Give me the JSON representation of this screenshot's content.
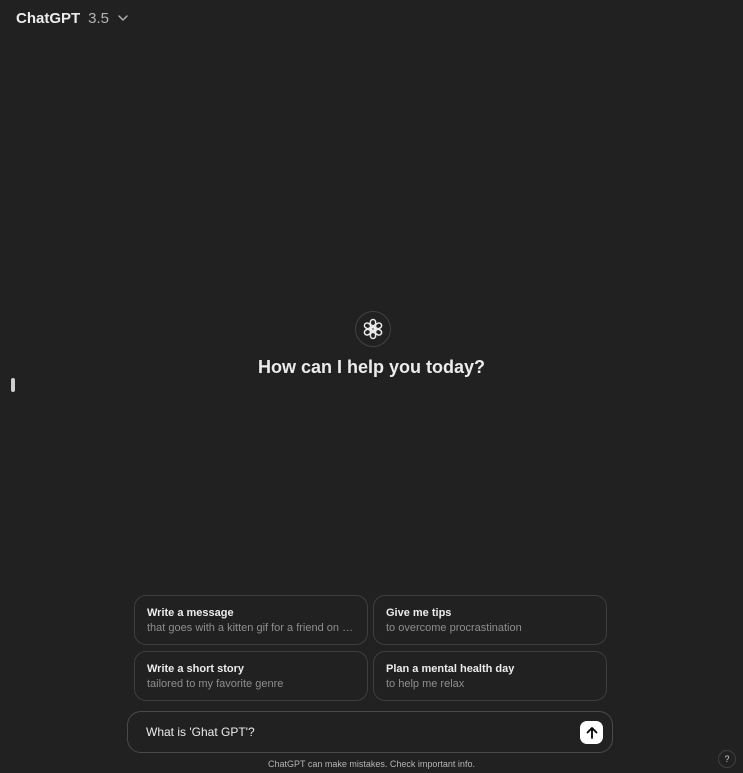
{
  "header": {
    "model_name": "ChatGPT",
    "model_version": "3.5",
    "chevron_icon": "chevron-down-icon"
  },
  "hero": {
    "logo_icon": "openai-logo-icon",
    "greeting": "How can I help you today?"
  },
  "suggestions": [
    {
      "title": "Write a message",
      "subtitle": "that goes with a kitten gif for a friend on a r..."
    },
    {
      "title": "Give me tips",
      "subtitle": "to overcome procrastination"
    },
    {
      "title": "Write a short story",
      "subtitle": "tailored to my favorite genre"
    },
    {
      "title": "Plan a mental health day",
      "subtitle": "to help me relax"
    }
  ],
  "composer": {
    "value": "What is 'Ghat GPT'?",
    "send_icon": "arrow-up-icon"
  },
  "footer": {
    "disclaimer": "ChatGPT can make mistakes. Check important info.",
    "help_label": "?"
  },
  "colors": {
    "background": "#212121",
    "border": "#3e3e3e",
    "text_primary": "#ececec",
    "text_secondary": "#8e8e8e",
    "send_button": "#ffffff"
  }
}
